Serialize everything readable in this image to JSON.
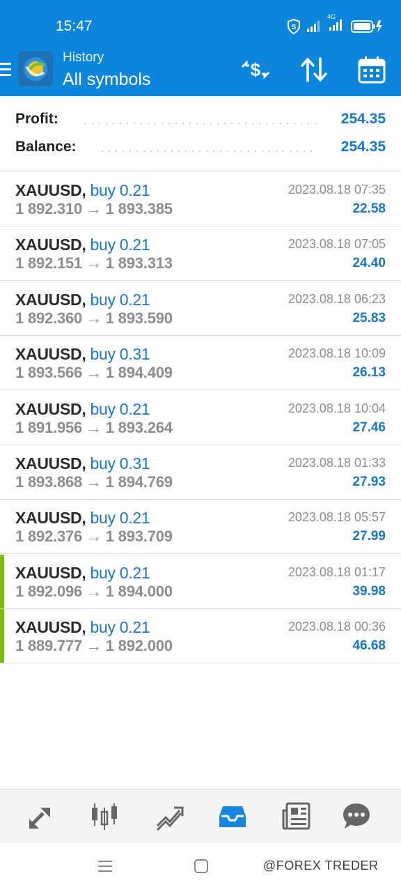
{
  "status_bar": {
    "time": "15:47",
    "network": "4G"
  },
  "header": {
    "title_small": "History",
    "title_big": "All symbols"
  },
  "summary": {
    "profit_label": "Profit:",
    "profit_value": "254.35",
    "balance_label": "Balance:",
    "balance_value": "254.35"
  },
  "deals": [
    {
      "symbol": "XAUUSD,",
      "side": "buy 0.21",
      "open": "1 892.310",
      "arrow": "→",
      "close": "1 893.385",
      "time": "2023.08.18 07:35",
      "profit": "22.58",
      "accent": false
    },
    {
      "symbol": "XAUUSD,",
      "side": "buy 0.21",
      "open": "1 892.151",
      "arrow": "→",
      "close": "1 893.313",
      "time": "2023.08.18 07:05",
      "profit": "24.40",
      "accent": false
    },
    {
      "symbol": "XAUUSD,",
      "side": "buy 0.21",
      "open": "1 892.360",
      "arrow": "→",
      "close": "1 893.590",
      "time": "2023.08.18 06:23",
      "profit": "25.83",
      "accent": false
    },
    {
      "symbol": "XAUUSD,",
      "side": "buy 0.31",
      "open": "1 893.566",
      "arrow": "→",
      "close": "1 894.409",
      "time": "2023.08.18 10:09",
      "profit": "26.13",
      "accent": false
    },
    {
      "symbol": "XAUUSD,",
      "side": "buy 0.21",
      "open": "1 891.956",
      "arrow": "→",
      "close": "1 893.264",
      "time": "2023.08.18 10:04",
      "profit": "27.46",
      "accent": false
    },
    {
      "symbol": "XAUUSD,",
      "side": "buy 0.31",
      "open": "1 893.868",
      "arrow": "→",
      "close": "1 894.769",
      "time": "2023.08.18 01:33",
      "profit": "27.93",
      "accent": false
    },
    {
      "symbol": "XAUUSD,",
      "side": "buy 0.21",
      "open": "1 892.376",
      "arrow": "→",
      "close": "1 893.709",
      "time": "2023.08.18 05:57",
      "profit": "27.99",
      "accent": false
    },
    {
      "symbol": "XAUUSD,",
      "side": "buy 0.21",
      "open": "1 892.096",
      "arrow": "→",
      "close": "1 894.000",
      "time": "2023.08.18 01:17",
      "profit": "39.98",
      "accent": true
    },
    {
      "symbol": "XAUUSD,",
      "side": "buy 0.21",
      "open": "1 889.777",
      "arrow": "→",
      "close": "1 892.000",
      "time": "2023.08.18 00:36",
      "profit": "46.68",
      "accent": true
    }
  ],
  "bottom_nav": [
    {
      "icon": "quotes-icon",
      "active": false
    },
    {
      "icon": "chart-icon",
      "active": false
    },
    {
      "icon": "trade-icon",
      "active": false
    },
    {
      "icon": "history-icon",
      "active": true
    },
    {
      "icon": "news-icon",
      "active": false
    },
    {
      "icon": "chat-icon",
      "active": false
    }
  ],
  "watermark": "@FOREX TREDER",
  "colors": {
    "primary": "#0c85dc",
    "accent_blue": "#1878c9",
    "profit_green": "#7cbd0e",
    "gray_text": "#8d8d8d"
  }
}
